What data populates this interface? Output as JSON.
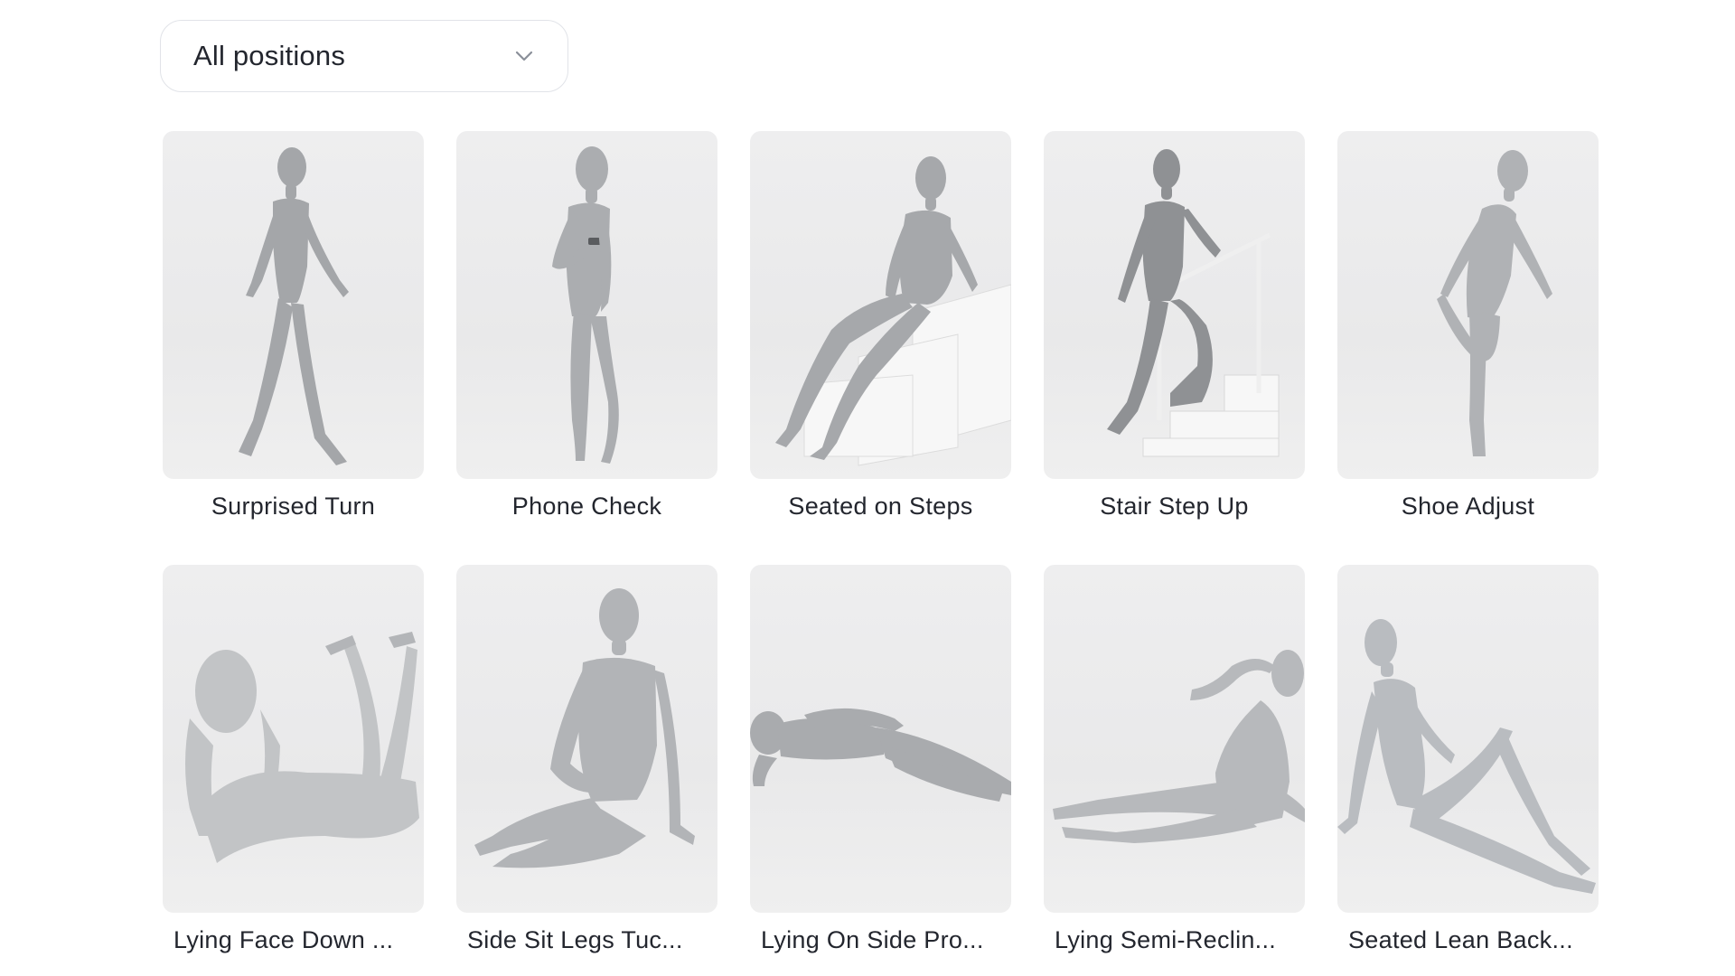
{
  "filter": {
    "selected": "All positions",
    "icon": "chevron-down-icon"
  },
  "poses": [
    {
      "label": "Surprised Turn"
    },
    {
      "label": "Phone Check"
    },
    {
      "label": "Seated on Steps"
    },
    {
      "label": "Stair Step Up"
    },
    {
      "label": "Shoe Adjust"
    },
    {
      "label": "Lying Face Down ..."
    },
    {
      "label": "Side Sit Legs Tuc..."
    },
    {
      "label": "Lying On Side Pro..."
    },
    {
      "label": "Lying Semi-Reclin..."
    },
    {
      "label": "Seated Lean Back..."
    }
  ],
  "colors": {
    "mannequin": "#a9abae",
    "mannequin_shadow": "#8e9093",
    "prop": "#f6f6f6",
    "background": "#ebebec"
  }
}
